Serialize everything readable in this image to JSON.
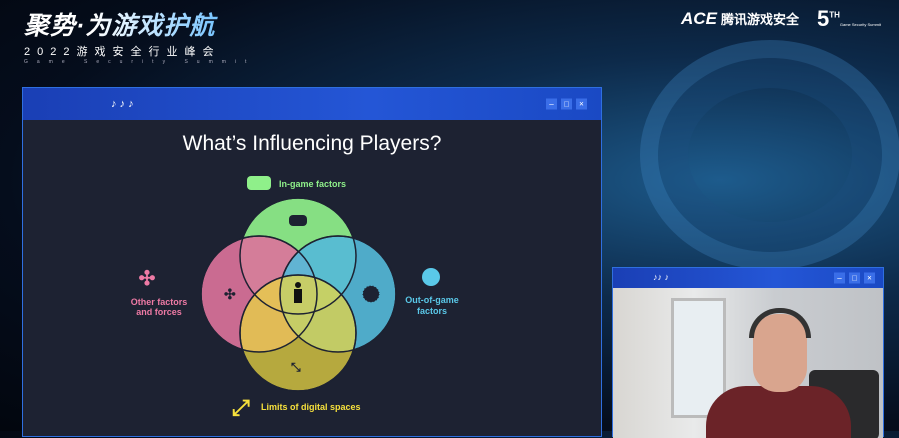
{
  "event": {
    "title": "聚势·为游戏护航",
    "subtitle": "2022游戏安全行业峰会",
    "subtitle_en": "Game Security Summit"
  },
  "logos": {
    "ace": "ACE",
    "ace_cn": "腾讯游戏安全",
    "fifth": "5",
    "fifth_sup": "TH",
    "fifth_small": "Game Security Summit"
  },
  "slide_window": {
    "title_notes": "♪ ♪   ♪",
    "buttons": [
      "–",
      "□",
      "×"
    ]
  },
  "slide": {
    "title": "What’s Influencing Players?",
    "labels": {
      "top": "In-game factors",
      "left_1": "Other factors",
      "left_2": "and forces",
      "right_1": "Out-of-game",
      "right_2": "factors",
      "bottom": "Limits of digital spaces"
    },
    "colors": {
      "green": "#8ff08a",
      "pink": "#ee7aa5",
      "blue": "#5ac8e8",
      "yellow": "#fbe645",
      "green_text": "#8ff08a",
      "pink_text": "#ee7aa5",
      "blue_text": "#5ac8e8",
      "yellow_text": "#f6e03c"
    }
  },
  "webcam_window": {
    "title_notes": "♪♪  ♪",
    "buttons": [
      "–",
      "□",
      "×"
    ]
  }
}
